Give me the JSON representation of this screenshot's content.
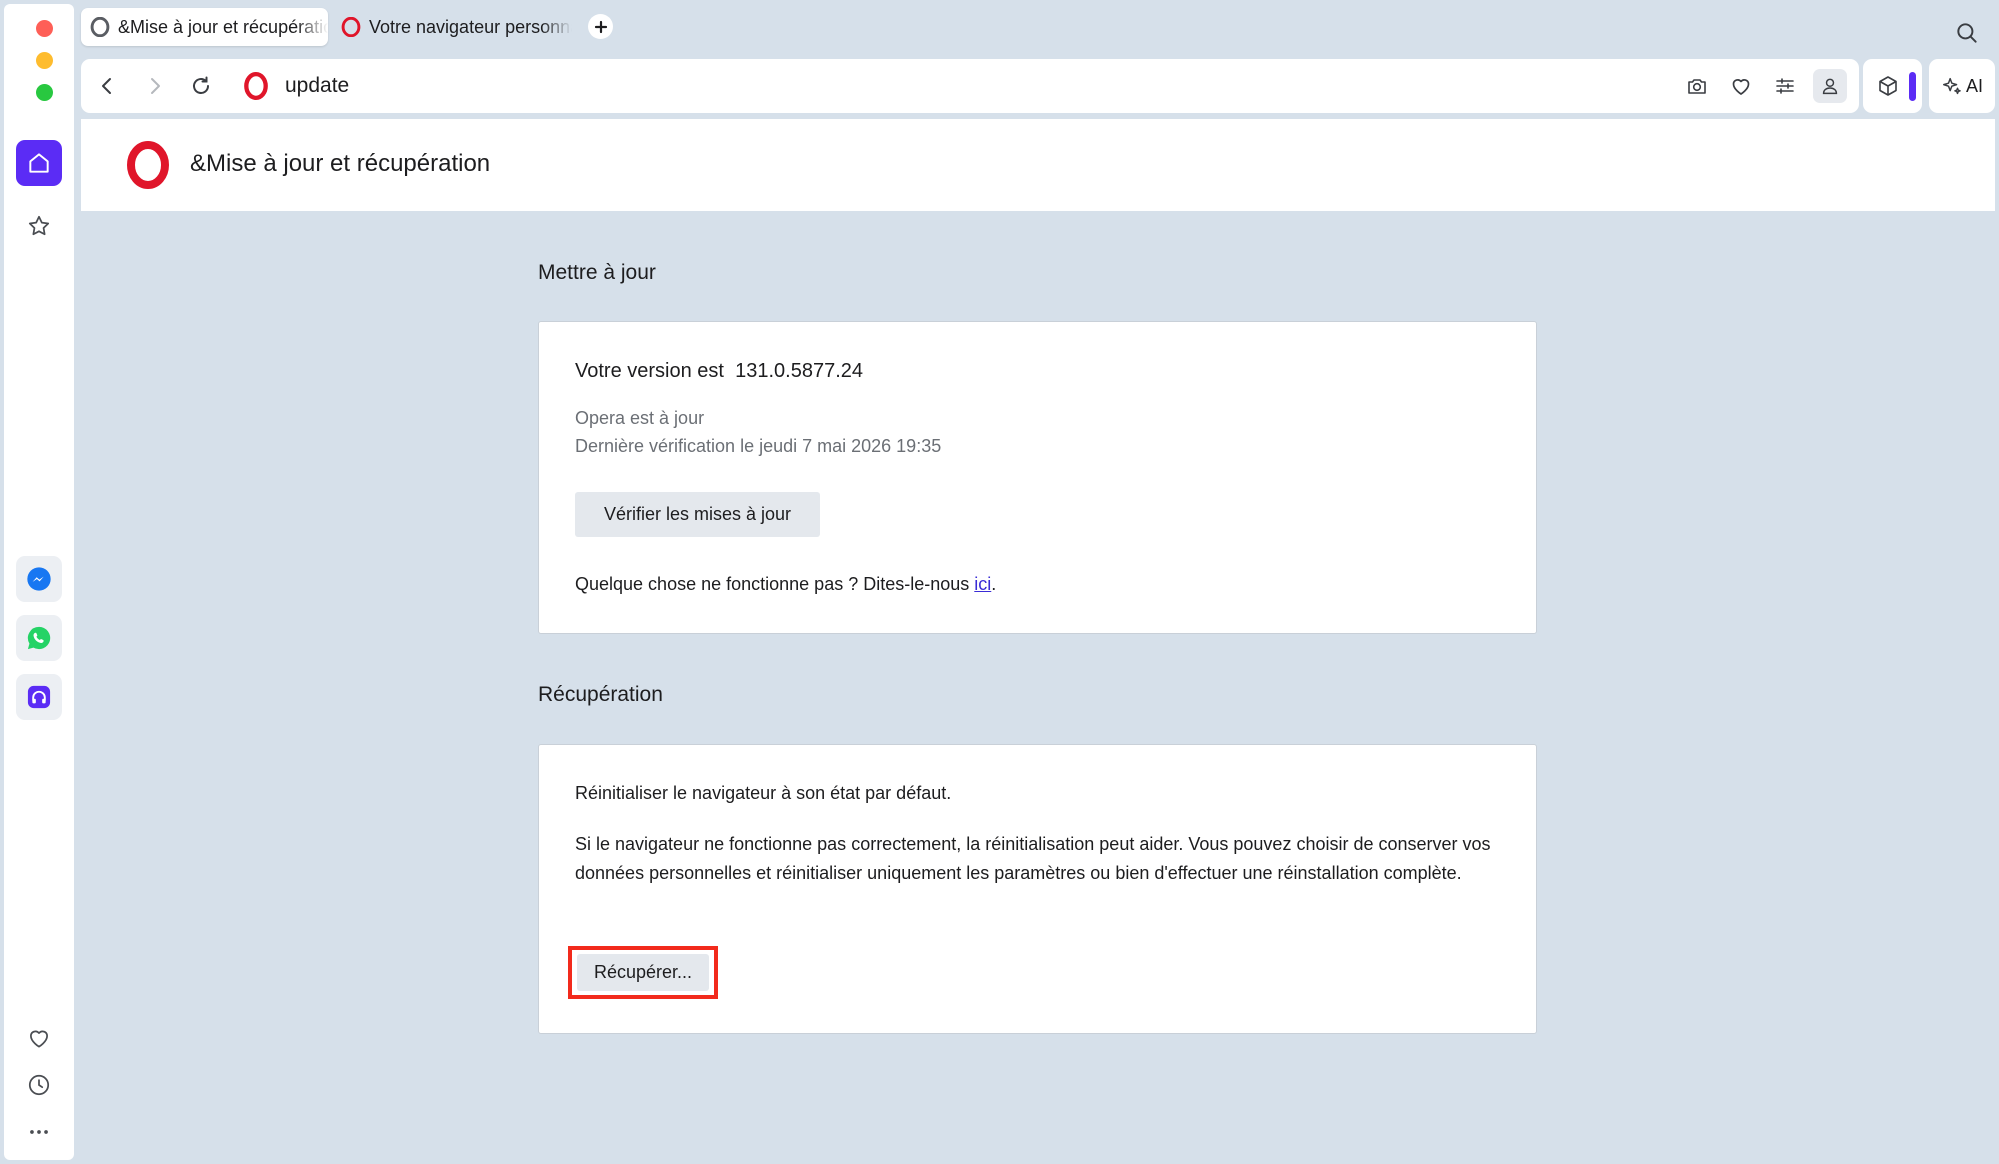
{
  "tabs": [
    {
      "label": "&Mise à jour et récupération",
      "active": true
    },
    {
      "label": "Votre navigateur personnalisé",
      "active": false
    }
  ],
  "address": {
    "url": "update"
  },
  "ai_button_label": "AI",
  "page": {
    "header_title": "&Mise à jour et récupération",
    "update_section": {
      "title": "Mettre à jour",
      "version_label": "Votre version est",
      "version_value": "131.0.5877.24",
      "status": "Opera est à jour",
      "last_check": "Dernière vérification le jeudi 7 mai 2026 19:35",
      "check_button": "Vérifier les mises à jour",
      "feedback_text": "Quelque chose ne fonctionne pas ? Dites-le-nous ",
      "feedback_link": "ici",
      "feedback_end": "."
    },
    "recovery_section": {
      "title": "Récupération",
      "reset_title": "Réinitialiser le navigateur à son état par défaut.",
      "reset_description": "Si le navigateur ne fonctionne pas correctement, la réinitialisation peut aider. Vous pouvez choisir de conserver vos données personnelles et réinitialiser uniquement les paramètres ou bien d'effectuer une réinstallation complète.",
      "recover_button": "Récupérer..."
    }
  },
  "colors": {
    "accent": "#5b2cf5",
    "opera_red": "#e0152a",
    "highlight_border": "#f22a1c",
    "page_background": "#d6e0ea"
  },
  "icons": {
    "sidebar": [
      "home-icon",
      "star-icon",
      "messenger-icon",
      "whatsapp-icon",
      "music-player-icon",
      "heart-icon",
      "history-clock-icon",
      "more-icon"
    ],
    "toolbar": [
      "camera-icon",
      "heart-icon",
      "sliders-icon",
      "profile-icon",
      "cube-icon",
      "ai-sparkle-icon"
    ]
  }
}
